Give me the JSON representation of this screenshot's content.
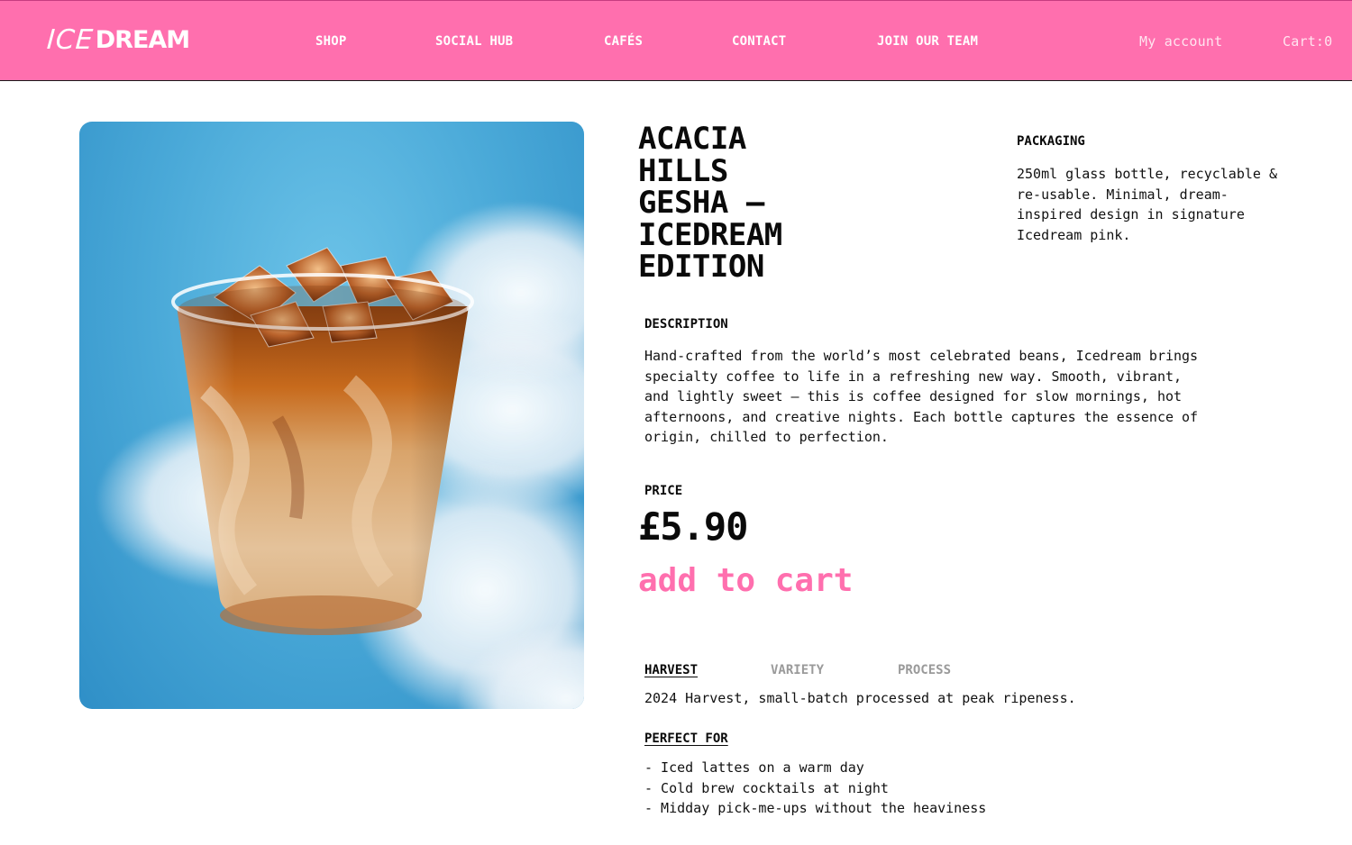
{
  "brand": {
    "logo_thin": "ICE",
    "logo_bold": "DREAM"
  },
  "nav": {
    "items": [
      "SHOP",
      "SOCIAL HUB",
      "CAFÉS",
      "CONTACT",
      "JOIN OUR TEAM"
    ],
    "account": "My account",
    "cart": "Cart:0"
  },
  "product": {
    "title_lines": [
      "ACACIA",
      "HILLS",
      "GESHA –",
      "ICEDREAM",
      "EDITION"
    ],
    "packaging_label": "PACKAGING",
    "packaging_text": "250ml glass bottle, recyclable & re-usable. Minimal, dream-inspired design in signature Icedream pink.",
    "description_label": "DESCRIPTION",
    "description_text": "Hand-crafted from the world’s most celebrated beans, Icedream brings specialty coffee to life in a refreshing new way. Smooth, vibrant, and lightly sweet — this is coffee designed for slow mornings, hot afternoons, and creative nights. Each bottle captures the essence of origin, chilled to perfection.",
    "price_label": "PRICE",
    "price": "£5.90",
    "add_to_cart": "add to cart",
    "tabs": [
      "HARVEST",
      "VARIETY",
      "PROCESS"
    ],
    "active_tab": "HARVEST",
    "harvest_text": "2024 Harvest, small-batch processed at peak ripeness.",
    "perfect_for_label": "PERFECT FOR",
    "perfect_for": [
      "- Iced lattes on a warm day",
      "- Cold brew cocktails at night",
      "- Midday pick-me-ups without the heaviness"
    ],
    "image_alt": "iced-coffee-cup-on-sky"
  },
  "colors": {
    "brand_pink": "#ff6fae",
    "sky_blue": "#4aa9d8",
    "text": "#0a0a0a",
    "muted": "#9a9a9a"
  }
}
